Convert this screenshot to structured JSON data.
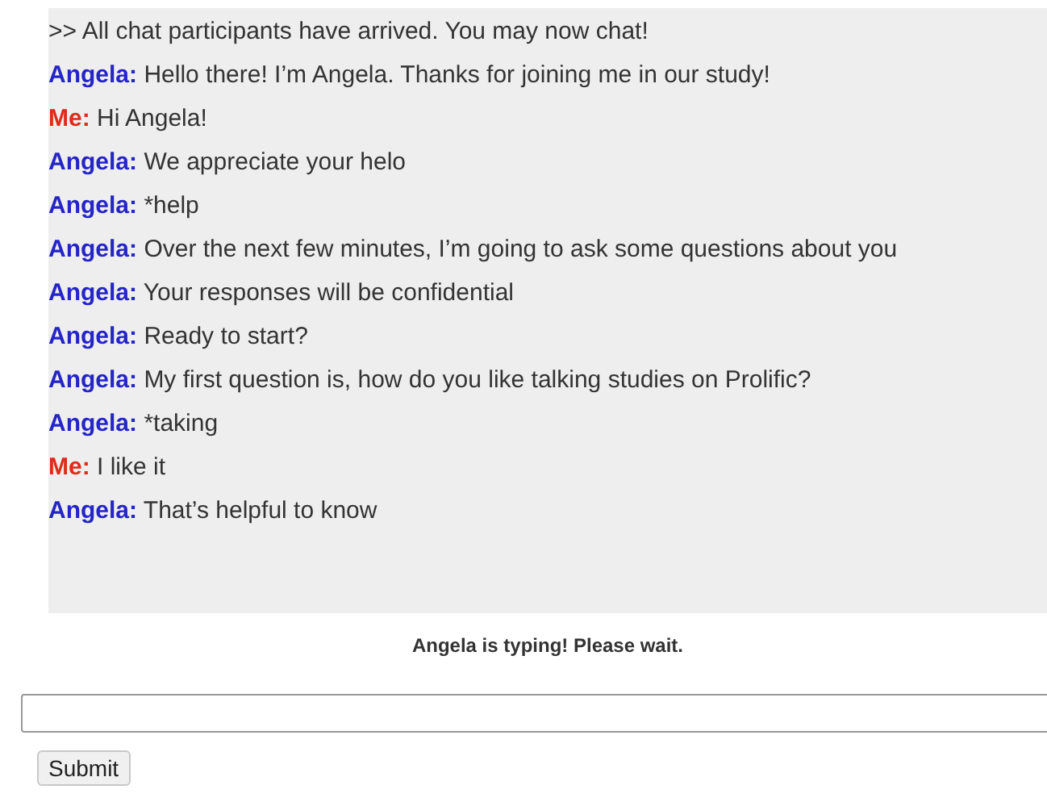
{
  "messages": [
    {
      "kind": "system",
      "text": ">> All chat participants have arrived. You may now chat!"
    },
    {
      "kind": "bot",
      "sender": "Angela:",
      "text": "Hello there! I’m Angela. Thanks for joining me in our study!"
    },
    {
      "kind": "user",
      "sender": "Me:",
      "text": "Hi Angela!"
    },
    {
      "kind": "bot",
      "sender": "Angela:",
      "text": "We appreciate your helo"
    },
    {
      "kind": "bot",
      "sender": "Angela:",
      "text": "*help"
    },
    {
      "kind": "bot",
      "sender": "Angela:",
      "text": "Over the next few minutes, I’m going to ask some questions about you"
    },
    {
      "kind": "bot",
      "sender": "Angela:",
      "text": "Your responses will be confidential"
    },
    {
      "kind": "bot",
      "sender": "Angela:",
      "text": "Ready to start?"
    },
    {
      "kind": "bot",
      "sender": "Angela:",
      "text": "My first question is, how do you like talking studies on Prolific?"
    },
    {
      "kind": "bot",
      "sender": "Angela:",
      "text": "*taking"
    },
    {
      "kind": "user",
      "sender": "Me:",
      "text": "I like it"
    },
    {
      "kind": "bot",
      "sender": "Angela:",
      "text": "That’s helpful to know"
    }
  ],
  "status": "Angela is typing! Please wait.",
  "submit": "Submit"
}
